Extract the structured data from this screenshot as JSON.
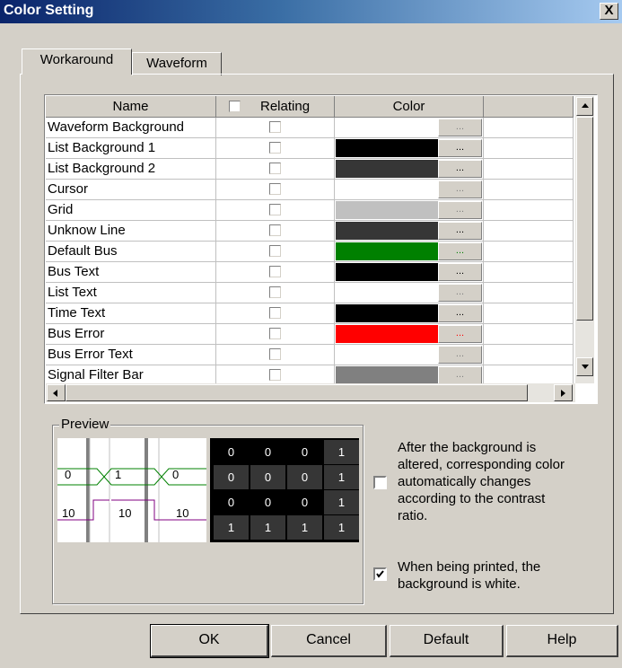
{
  "window": {
    "title": "Color Setting",
    "close_glyph": "X"
  },
  "tabs": [
    {
      "label": "Workaround",
      "active": true
    },
    {
      "label": "Waveform",
      "active": false
    }
  ],
  "grid": {
    "columns": [
      "Name",
      "Relating",
      "Color"
    ],
    "rows": [
      {
        "name": "Waveform Background",
        "color": "#ffffff"
      },
      {
        "name": "List Background 1",
        "color": "#000000"
      },
      {
        "name": "List Background 2",
        "color": "#363636"
      },
      {
        "name": "Cursor",
        "color": "#ffffff"
      },
      {
        "name": "Grid",
        "color": "#c0c0c0"
      },
      {
        "name": "Unknow Line",
        "color": "#363636"
      },
      {
        "name": "Default Bus",
        "color": "#008000"
      },
      {
        "name": "Bus Text",
        "color": "#000000"
      },
      {
        "name": "List Text",
        "color": "#ffffff"
      },
      {
        "name": "Time Text",
        "color": "#000000"
      },
      {
        "name": "Bus Error",
        "color": "#ff0000"
      },
      {
        "name": "Bus Error Text",
        "color": "#ffffff"
      },
      {
        "name": "Signal Filter Bar",
        "color": "#808080"
      }
    ],
    "button_label": "...",
    "scroll_position": 0.35
  },
  "preview": {
    "label": "Preview",
    "wave": {
      "top_values": [
        "0",
        "1",
        "0"
      ],
      "bottom_values": [
        "10",
        "10",
        "10"
      ]
    },
    "list": [
      [
        "0",
        "0",
        "0",
        "1"
      ],
      [
        "0",
        "0",
        "0",
        "1"
      ],
      [
        "0",
        "0",
        "0",
        "1"
      ],
      [
        "1",
        "1",
        "1",
        "1"
      ]
    ]
  },
  "options": {
    "contrast": {
      "checked": false,
      "lines": [
        "After the background is",
        "altered, corresponding color",
        "automatically changes",
        "according to the contrast",
        "ratio."
      ]
    },
    "print_white": {
      "checked": true,
      "lines": [
        "When being printed, the",
        "background is white."
      ]
    }
  },
  "buttons": {
    "ok": "OK",
    "cancel": "Cancel",
    "default": "Default",
    "help": "Help"
  },
  "colors": {
    "title_start": "#0a246a",
    "title_end": "#a6caf0",
    "bus_green": "#008000",
    "bus_purple": "#800080"
  }
}
